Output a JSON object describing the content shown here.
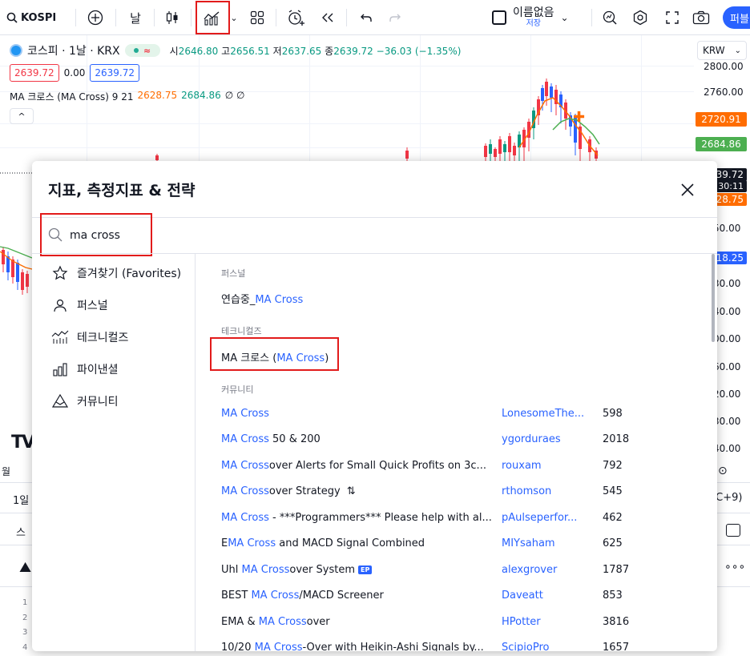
{
  "toolbar": {
    "symbol": "KOSPI",
    "interval": "날",
    "save_name": "이름없음",
    "save_sub": "저장",
    "publish_label": "퍼블"
  },
  "chart": {
    "legend_name": "코스피 · 1날 · KRX",
    "ohlc": {
      "open_key": "시",
      "open": "2646.80",
      "high_key": "고",
      "high": "2656.51",
      "low_key": "저",
      "low": "2637.65",
      "close_key": "종",
      "close": "2639.72",
      "change": "−36.03 (−1.35%)"
    },
    "sell_price": "2639.72",
    "spread": "0.00",
    "buy_price": "2639.72",
    "indicator": {
      "name": "MA 크로스 (MA Cross) 9 21",
      "ma_fast": "2628.75",
      "ma_slow": "2684.86",
      "extra": "∅ ∅"
    },
    "currency": "KRW",
    "axis": {
      "labels": [
        "2800.00",
        "2760.00",
        "50.00",
        "30.00",
        "40.00",
        "00.00",
        "60.00",
        "20.00",
        "30.00",
        "40.00"
      ],
      "tag_orange": "2720.91",
      "tag_green": "2684.86",
      "tag_dark_top": "39.72",
      "tag_dark_bottom": "30:11",
      "tag_orange2": "28.75",
      "tag_blue": "18.25",
      "timezone": "TC+9)"
    },
    "colors": {
      "up": "#089981",
      "down": "#f23645",
      "ma_fast": "#ff6d00",
      "ma_slow": "#4caf50"
    }
  },
  "background_fragments": {
    "tv_logo": "TV",
    "month_label": "월",
    "range_label": "1일",
    "panel_label": "스",
    "line_numbers": [
      "1",
      "2",
      "3",
      "4"
    ]
  },
  "dialog": {
    "title": "지표, 측정지표 & 전략",
    "search_value": "ma cross",
    "sidebar": [
      {
        "label": "즐겨찾기 (Favorites)",
        "icon": "star-icon"
      },
      {
        "label": "퍼스널",
        "icon": "user-icon"
      },
      {
        "label": "테크니컬즈",
        "icon": "technicals-icon"
      },
      {
        "label": "파이낸셜",
        "icon": "financials-icon"
      },
      {
        "label": "커뮤니티",
        "icon": "community-icon"
      }
    ],
    "sections": {
      "personal": "퍼스널",
      "technicals": "테크니컬즈",
      "community": "커뮤니티"
    },
    "personal_item": {
      "prefix": "연습중_",
      "match": "MA Cross"
    },
    "technical_item": {
      "prefix": "MA 크로스 (",
      "match": "MA Cross",
      "suffix": ")"
    },
    "community": [
      {
        "pre": "",
        "match": "MA Cross",
        "post": "",
        "author": "LonesomeThe...",
        "count": "598"
      },
      {
        "pre": "",
        "match": "MA Cross",
        "post": " 50 & 200",
        "author": "ygorduraes",
        "count": "2018"
      },
      {
        "pre": "",
        "match": "MA Cross",
        "post": "over Alerts for Small Quick Profits on 3c...",
        "author": "rouxam",
        "count": "792"
      },
      {
        "pre": "",
        "match": "MA Cross",
        "post": "over Strategy",
        "author": "rthomson",
        "count": "545",
        "strategy": true
      },
      {
        "pre": "",
        "match": "MA Cross",
        "post": " - ***Programmers*** Please help with al...",
        "author": "pAulseperfor...",
        "count": "462"
      },
      {
        "pre": "E",
        "match": "MA Cross",
        "post": " and MACD Signal Combined",
        "author": "MIYsaham",
        "count": "625"
      },
      {
        "pre": "Uhl ",
        "match": "MA Cross",
        "post": "over System",
        "author": "alexgrover",
        "count": "1787",
        "badge": "EP"
      },
      {
        "pre": "BEST ",
        "match": "MA Cross",
        "post": "/MACD Screener",
        "author": "Daveatt",
        "count": "853"
      },
      {
        "pre": "EMA & ",
        "match": "MA Cross",
        "post": "over",
        "author": "HPotter",
        "count": "3816"
      },
      {
        "pre": "10/20 ",
        "match": "MA Cross",
        "post": "-Over with Heikin-Ashi Signals by...",
        "author": "ScipioPro",
        "count": "1657"
      }
    ]
  }
}
